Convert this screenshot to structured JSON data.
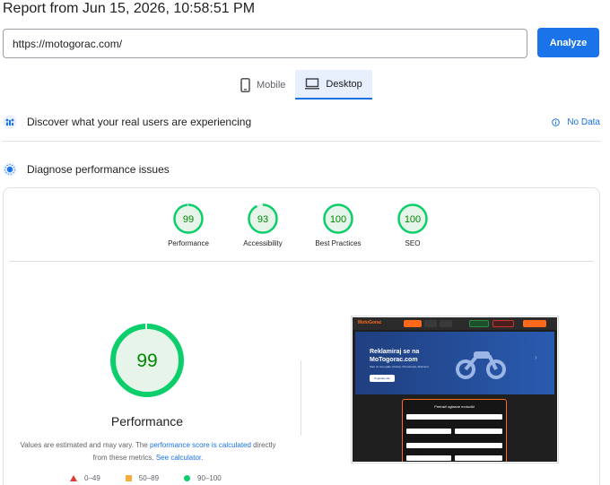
{
  "report": {
    "title": "Report from Jun 15, 2026, 10:58:51 PM"
  },
  "url_input": {
    "value": "https://motogorac.com/"
  },
  "analyze_button": {
    "label": "Analyze"
  },
  "device_tabs": [
    {
      "label": "Mobile",
      "icon": "phone-icon",
      "active": false
    },
    {
      "label": "Desktop",
      "icon": "monitor-icon",
      "active": true
    }
  ],
  "field_data": {
    "text": "Discover what your real users are experiencing",
    "status": "No Data",
    "icon": "users-data-icon"
  },
  "diagnose": {
    "text": "Diagnose performance issues",
    "icon": "lab-data-icon"
  },
  "scores": [
    {
      "value": "99",
      "label": "Performance",
      "fraction": 0.99
    },
    {
      "value": "93",
      "label": "Accessibility",
      "fraction": 0.93
    },
    {
      "value": "100",
      "label": "Best Practices",
      "fraction": 1.0
    },
    {
      "value": "100",
      "label": "SEO",
      "fraction": 1.0
    }
  ],
  "performance": {
    "score": "99",
    "fraction": 0.99,
    "title": "Performance",
    "note_prefix": "Values are estimated and may vary. The ",
    "note_link1": "performance score is calculated",
    "note_middle": " directly from these metrics. ",
    "note_link2": "See calculator."
  },
  "legend": [
    {
      "range": "0–49",
      "shape": "triangle",
      "color": "#e53935"
    },
    {
      "range": "50–89",
      "shape": "square",
      "color": "#fbaa3c"
    },
    {
      "range": "90–100",
      "shape": "circle",
      "color": "#0cce6b"
    }
  ],
  "screenshot": {
    "logo": "MotoGorac",
    "headline": "Reklamiraj se na MoTogorac.com",
    "subtext": "Sam cu tvoj oglas, Dostop, Prometnost, Aktivnost",
    "cta": "Pogledaj više",
    "form_title": "Pretraži oglasne motocikl"
  },
  "colors": {
    "accent": "#1a73e8",
    "good": "#0cce6b",
    "good_text": "#008800",
    "good_bg": "#e6f4ea"
  }
}
